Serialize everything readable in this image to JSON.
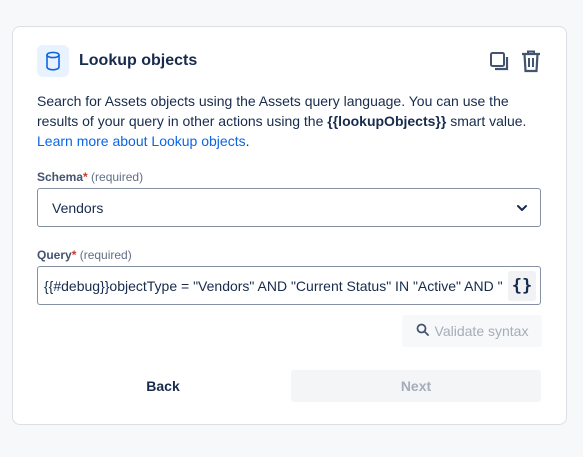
{
  "card": {
    "title": "Lookup objects",
    "icons": {
      "header": "database-icon",
      "copy": "copy-icon",
      "delete": "trash-icon"
    },
    "description": {
      "text_before": "Search for Assets objects using the Assets query language. You can use the results of your query in other actions using the ",
      "smart_value": "{{lookupObjects}}",
      "text_after": " smart value.",
      "link_text": "Learn more about Lookup objects",
      "link_suffix": "."
    }
  },
  "schema": {
    "label": "Schema",
    "required_mark": "*",
    "required_text": "(required)",
    "value": "Vendors",
    "icon": "chevron-down-icon"
  },
  "query": {
    "label": "Query",
    "required_mark": "*",
    "required_text": "(required)",
    "value": "{{#debug}}objectType = \"Vendors\" AND \"Current Status\" IN \"Active\" AND \"",
    "smart_value_button": "{}"
  },
  "validate": {
    "label": "Validate syntax",
    "icon": "search-icon"
  },
  "footer": {
    "back_label": "Back",
    "next_label": "Next"
  },
  "colors": {
    "link": "#0c66e4",
    "required": "#c9372c",
    "icon_tile_bg": "#e9f2ff",
    "disabled_text": "#a5adba"
  }
}
